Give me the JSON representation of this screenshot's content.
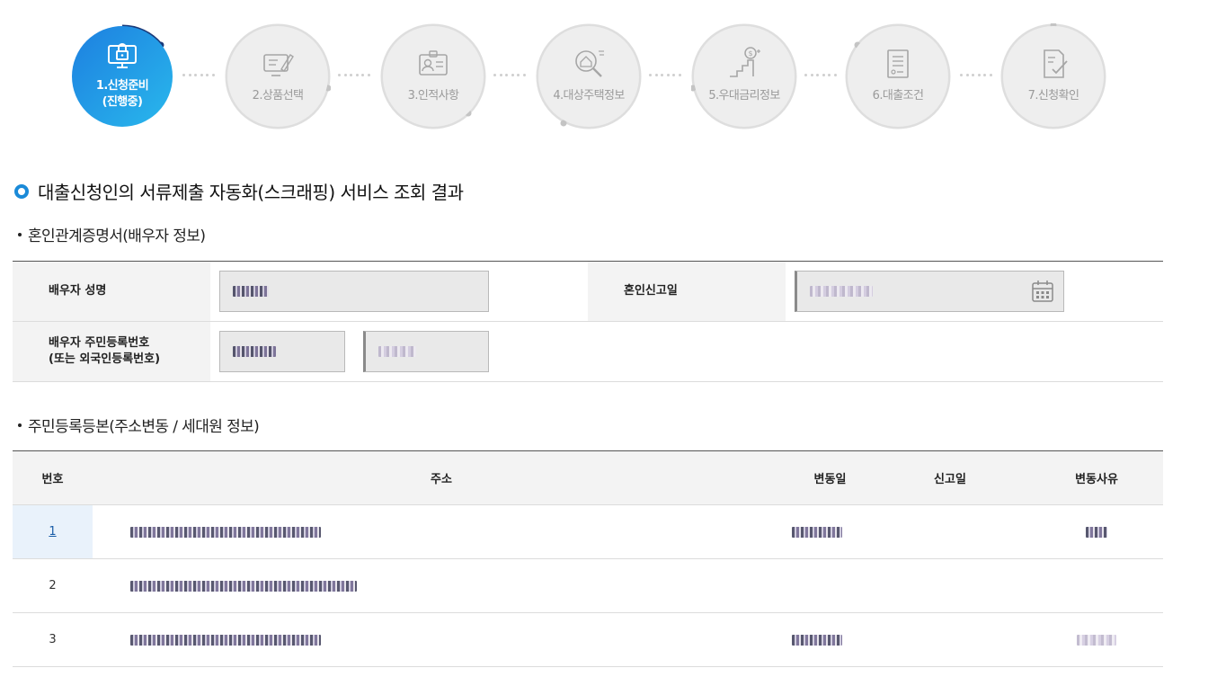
{
  "steps": [
    {
      "label": "1.신청준비",
      "sub": "(진행중)",
      "icon": "monitor-lock-icon",
      "active": true
    },
    {
      "label": "2.상품선택",
      "icon": "monitor-edit-icon",
      "active": false
    },
    {
      "label": "3.인적사항",
      "icon": "id-card-icon",
      "active": false
    },
    {
      "label": "4.대상주택정보",
      "icon": "house-search-icon",
      "active": false
    },
    {
      "label": "5.우대금리정보",
      "icon": "stairs-coin-icon",
      "active": false
    },
    {
      "label": "6.대출조건",
      "icon": "document-list-icon",
      "active": false
    },
    {
      "label": "7.신청확인",
      "icon": "document-check-icon",
      "active": false
    }
  ],
  "colors": {
    "accent": "#1a8ad8",
    "active_grad_start": "#1d7fe0",
    "active_grad_end": "#29b8ec",
    "inactive": "#eeeeee"
  },
  "page_title": "대출신청인의 서류제출 자동화(스크래핑) 서비스 조회 결과",
  "marriage": {
    "section_title": "혼인관계증명서(배우자 정보)",
    "spouse_name_label": "배우자 성명",
    "report_date_label": "혼인신고일",
    "spouse_id_label_1": "배우자 주민등록번호",
    "spouse_id_label_2": "(또는 외국인등록번호)"
  },
  "resident": {
    "section_title": "주민등록등본(주소변동 / 세대원 정보)",
    "columns": {
      "no": "번호",
      "address": "주소",
      "change_date": "변동일",
      "report_date": "신고일",
      "reason": "변동사유"
    },
    "rows": [
      {
        "no": "1"
      },
      {
        "no": "2"
      },
      {
        "no": "3"
      }
    ]
  }
}
